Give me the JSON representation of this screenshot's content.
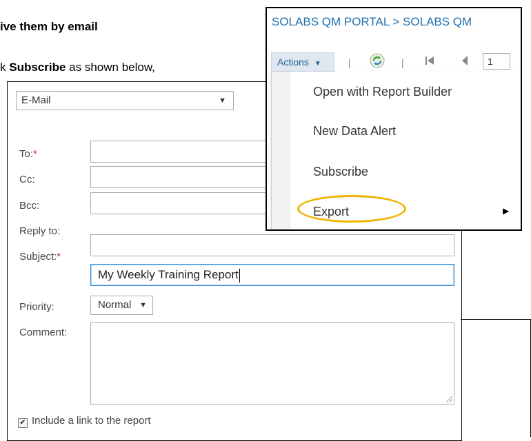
{
  "document": {
    "heading": "ive them by email",
    "line_prefix": "k ",
    "line_bold": "Subscribe",
    "line_suffix": " as shown below,"
  },
  "form": {
    "delivery_method": "E-Mail",
    "fields": {
      "to_label": "To:",
      "to_required": "*",
      "to_value": "",
      "cc_label": "Cc:",
      "cc_value": "",
      "bcc_label": "Bcc:",
      "bcc_value": "",
      "reply_label": "Reply to:",
      "reply_value": "",
      "subject_label": "Subject:",
      "subject_required": "*",
      "subject_value": "My Weekly Training Report",
      "priority_label": "Priority:",
      "priority_value": "Normal",
      "comment_label": "Comment:",
      "comment_value": ""
    },
    "include_link_label": "Include a link to the report",
    "include_link_checked": true
  },
  "report_menu": {
    "breadcrumb": "SOLABS QM PORTAL > SOLABS QM",
    "actions_label": "Actions",
    "page_number": "1",
    "items": [
      {
        "label": "Open with Report Builder"
      },
      {
        "label": "New Data Alert"
      },
      {
        "label": "Subscribe"
      },
      {
        "label": "Export",
        "has_submenu": true,
        "highlighted": true
      }
    ],
    "highlight_color": "#f0b400",
    "link_color": "#1f6fae"
  }
}
